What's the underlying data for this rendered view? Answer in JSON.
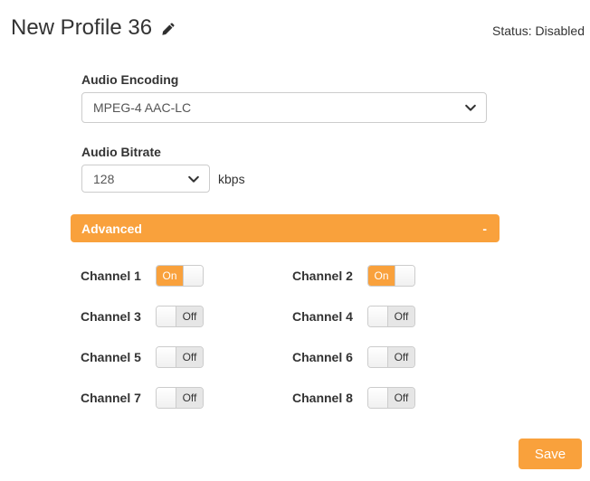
{
  "header": {
    "title": "New Profile 36",
    "status_label": "Status: Disabled"
  },
  "form": {
    "audio_encoding": {
      "label": "Audio Encoding",
      "value": "MPEG-4 AAC-LC"
    },
    "audio_bitrate": {
      "label": "Audio Bitrate",
      "value": "128",
      "unit": "kbps"
    },
    "advanced": {
      "label": "Advanced",
      "collapse_indicator": "-"
    }
  },
  "channels": [
    {
      "label": "Channel 1",
      "state": "On"
    },
    {
      "label": "Channel 2",
      "state": "On"
    },
    {
      "label": "Channel 3",
      "state": "Off"
    },
    {
      "label": "Channel 4",
      "state": "Off"
    },
    {
      "label": "Channel 5",
      "state": "Off"
    },
    {
      "label": "Channel 6",
      "state": "Off"
    },
    {
      "label": "Channel 7",
      "state": "Off"
    },
    {
      "label": "Channel 8",
      "state": "Off"
    }
  ],
  "footer": {
    "save_label": "Save"
  },
  "colors": {
    "accent_orange": "#f9a13c",
    "toggle_off_bg": "#e6e6e6",
    "control_border": "#cccccc",
    "text": "#333333"
  }
}
